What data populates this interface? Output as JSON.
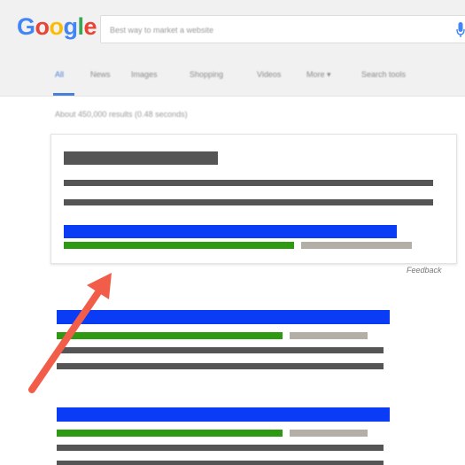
{
  "header": {
    "logo_letters": [
      {
        "char": "G",
        "color": "#4285f4"
      },
      {
        "char": "o",
        "color": "#ea4335"
      },
      {
        "char": "o",
        "color": "#fbbc05"
      },
      {
        "char": "g",
        "color": "#4285f4"
      },
      {
        "char": "l",
        "color": "#34a853"
      },
      {
        "char": "e",
        "color": "#ea4335"
      }
    ],
    "search_value": "Best way to market a website",
    "mic_icon": "microphone-icon",
    "mic_color": "#4285f4"
  },
  "tabs": [
    {
      "label": "All",
      "active": true
    },
    {
      "label": "News",
      "active": false
    },
    {
      "label": "Images",
      "active": false
    },
    {
      "label": "Shopping",
      "active": false
    },
    {
      "label": "Videos",
      "active": false
    },
    {
      "label": "More ▾",
      "active": false
    },
    {
      "label": "Search tools",
      "active": false
    }
  ],
  "results_stats": "About 450,000 results (0.48 seconds)",
  "featured_snippet": {
    "feedback_label": "Feedback"
  },
  "colors": {
    "title_blue": "#0a3cf5",
    "url_green": "#2e9a12",
    "meta_gray": "#b3aea6",
    "text_dark": "#555555",
    "arrow": "#f15d49"
  },
  "annotation": {
    "arrow_icon": "arrow-icon"
  }
}
